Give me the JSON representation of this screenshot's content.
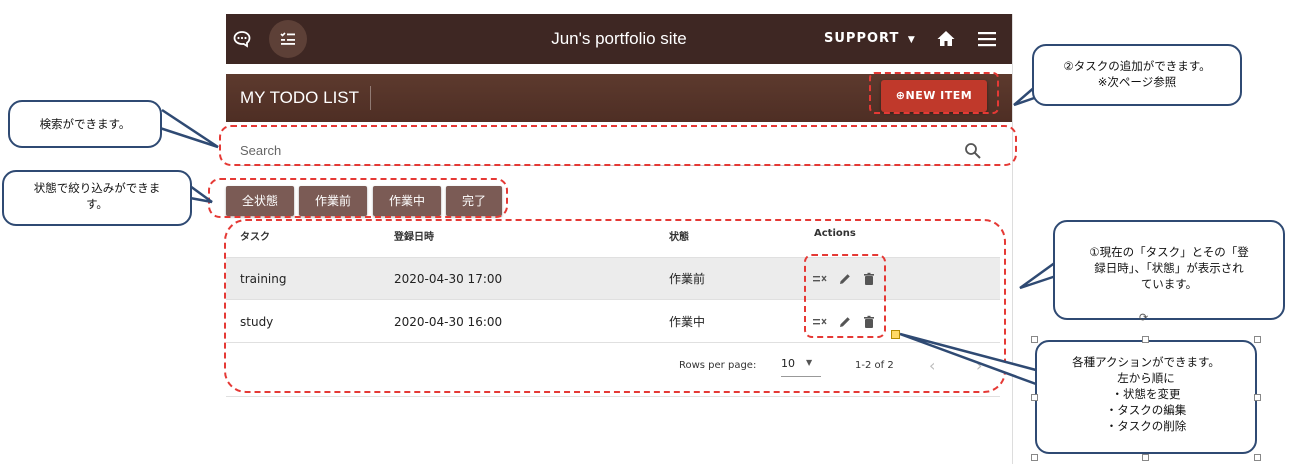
{
  "app": {
    "title": "Jun's portfolio site",
    "support_label": "SUPPORT",
    "header_title": "MY TODO LIST",
    "new_item_label": "NEW ITEM",
    "search_placeholder": "Search",
    "filters": [
      "全状態",
      "作業前",
      "作業中",
      "完了"
    ],
    "columns": {
      "task": "タスク",
      "date": "登録日時",
      "status": "状態",
      "actions": "Actions"
    },
    "rows": [
      {
        "task": "training",
        "date": "2020-04-30 17:00",
        "status": "作業前"
      },
      {
        "task": "study",
        "date": "2020-04-30 16:00",
        "status": "作業中"
      }
    ],
    "pagination": {
      "rows_per_page_label": "Rows per page:",
      "rows_per_page_value": "10",
      "range": "1-2 of 2"
    },
    "colors": {
      "appbar": "#3e2723",
      "header": "#5d3a2e",
      "accent": "#c0392b",
      "filter": "#7b5b55",
      "annotation_border": "#2f4a73",
      "dash": "#e53935"
    }
  },
  "callouts": {
    "search": "検索ができます。",
    "filter_line1": "状態で絞り込みができま",
    "filter_line2": "す。",
    "new_item_line1": "②タスクの追加ができます。",
    "new_item_line2": "※次ページ参照",
    "table_line1": "①現在の「タスク」とその「登",
    "table_line2": "録日時」、「状態」が表示され",
    "table_line3": "ています。",
    "actions_line1": "各種アクションができます。",
    "actions_line2": "左から順に",
    "actions_line3": "・状態を変更",
    "actions_line4": "・タスクの編集",
    "actions_line5": "・タスクの削除"
  }
}
